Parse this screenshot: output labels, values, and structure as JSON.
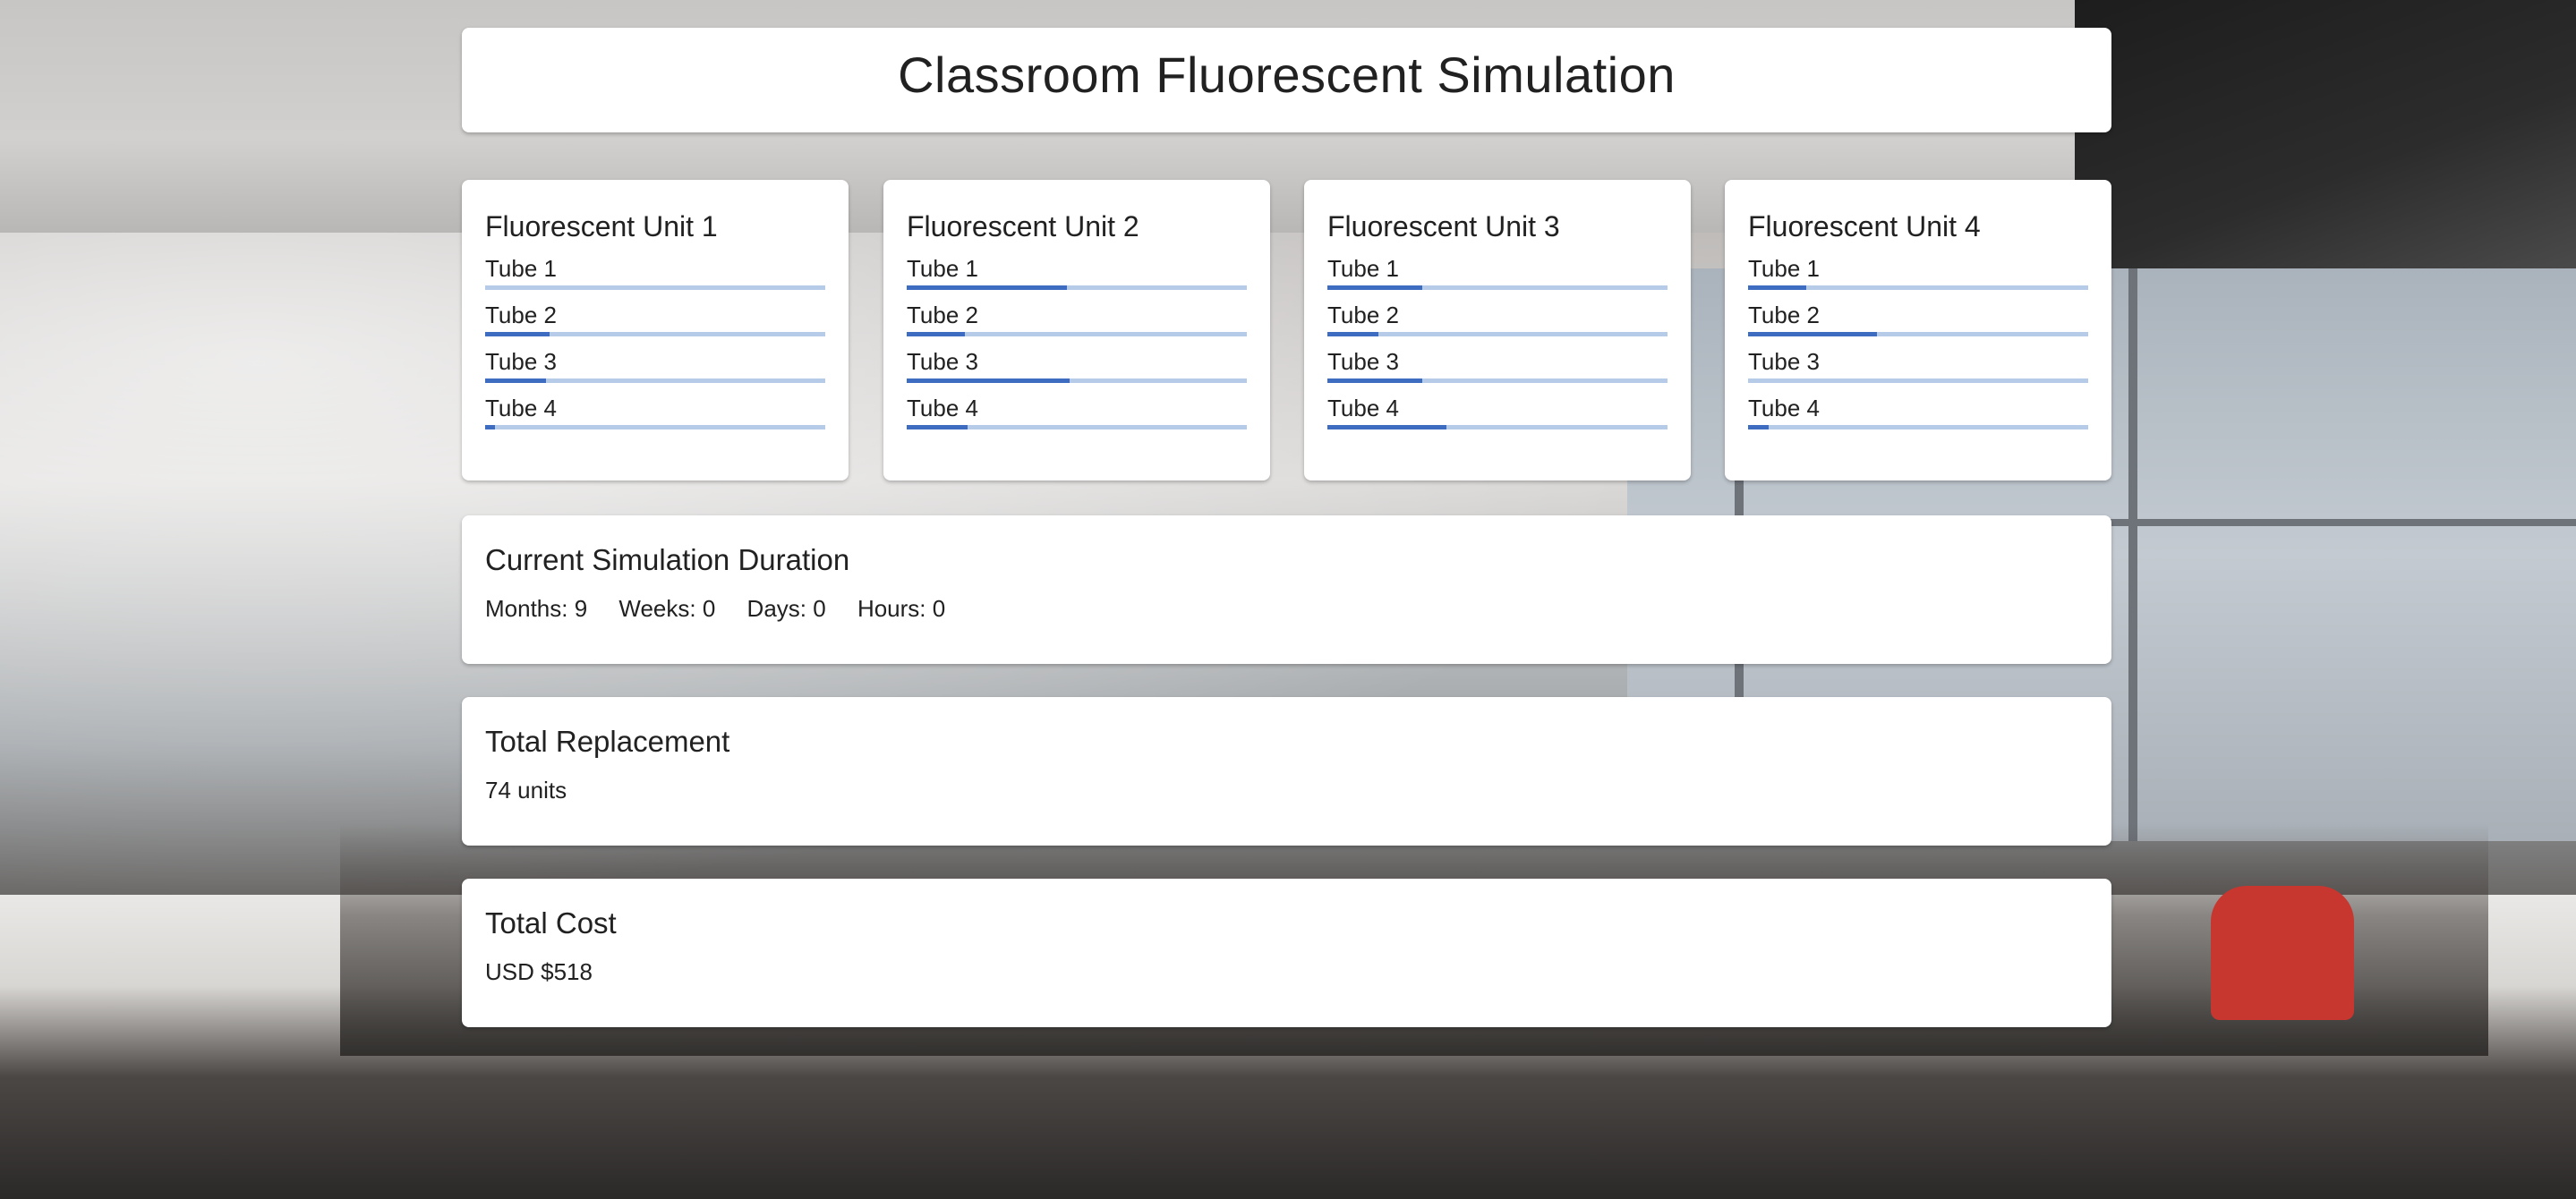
{
  "header": {
    "title": "Classroom Fluorescent Simulation"
  },
  "units": [
    {
      "title": "Fluorescent Unit 1",
      "tubes": [
        {
          "label": "Tube 1",
          "wear_fraction": 0.0
        },
        {
          "label": "Tube 2",
          "wear_fraction": 0.19
        },
        {
          "label": "Tube 3",
          "wear_fraction": 0.18
        },
        {
          "label": "Tube 4",
          "wear_fraction": 0.03
        }
      ]
    },
    {
      "title": "Fluorescent Unit 2",
      "tubes": [
        {
          "label": "Tube 1",
          "wear_fraction": 0.47
        },
        {
          "label": "Tube 2",
          "wear_fraction": 0.17
        },
        {
          "label": "Tube 3",
          "wear_fraction": 0.48
        },
        {
          "label": "Tube 4",
          "wear_fraction": 0.18
        }
      ]
    },
    {
      "title": "Fluorescent Unit 3",
      "tubes": [
        {
          "label": "Tube 1",
          "wear_fraction": 0.28
        },
        {
          "label": "Tube 2",
          "wear_fraction": 0.15
        },
        {
          "label": "Tube 3",
          "wear_fraction": 0.28
        },
        {
          "label": "Tube 4",
          "wear_fraction": 0.35
        }
      ]
    },
    {
      "title": "Fluorescent Unit 4",
      "tubes": [
        {
          "label": "Tube 1",
          "wear_fraction": 0.17
        },
        {
          "label": "Tube 2",
          "wear_fraction": 0.38
        },
        {
          "label": "Tube 3",
          "wear_fraction": 0.0
        },
        {
          "label": "Tube 4",
          "wear_fraction": 0.06
        }
      ]
    }
  ],
  "duration": {
    "title": "Current Simulation Duration",
    "months": "Months: 9",
    "weeks": "Weeks: 0",
    "days": "Days: 0",
    "hours": "Hours: 0"
  },
  "replacement": {
    "title": "Total Replacement",
    "value": "74 units"
  },
  "cost": {
    "title": "Total Cost",
    "value": "USD $518"
  },
  "colors": {
    "progress_track": "#b6cbe8",
    "progress_fill": "#3d6cc1",
    "card_bg": "#ffffff",
    "text": "#212121"
  }
}
